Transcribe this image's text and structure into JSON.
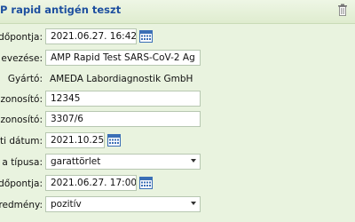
{
  "header": {
    "title": "P rapid antigén teszt",
    "trash_icon": "trash-icon"
  },
  "rows": [
    {
      "label": "időpontja:",
      "value": "2021.06.27. 16:42"
    },
    {
      "label": "evezése:",
      "value": "AMP Rapid Test SARS-CoV-2 Ag"
    },
    {
      "label": "Gyártó:",
      "value": "AMEDA Labordiagnostik GmbH"
    },
    {
      "label": "azonosító:",
      "value": "12345"
    },
    {
      "label": "azonosító:",
      "value": "3307/6"
    },
    {
      "label": "ati dátum:",
      "value": "2021.10.25."
    },
    {
      "label": "a típusa:",
      "value": "garattörlet"
    },
    {
      "label": "időpontja:",
      "value": "2021.06.27. 17:00"
    },
    {
      "label": "redmény:",
      "value": "pozitív"
    }
  ],
  "icons": {
    "calendar": "calendar-icon",
    "dropdown": "dropdown-arrow-icon"
  },
  "colors": {
    "background": "#e9f3df",
    "title": "#1d4f9f",
    "field_border": "#b7c7b1"
  }
}
